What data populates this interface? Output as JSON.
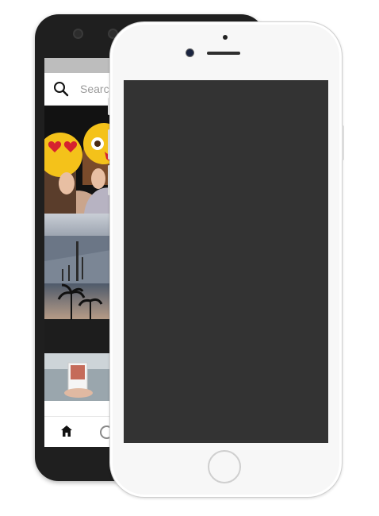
{
  "back_phone": {
    "search": {
      "placeholder": "Search",
      "icon": "search-icon"
    },
    "feed": [
      {
        "name": "emoji-masks-photo"
      },
      {
        "name": "pier-sea-photo"
      },
      {
        "name": "palm-sunset-photo"
      },
      {
        "name": "polaroid-photo"
      }
    ],
    "nav": {
      "home_icon": "home-icon",
      "explore_icon": "explore-icon"
    }
  },
  "front_phone": {
    "screen_color": "#333333",
    "body_color": "#f7f7f7"
  }
}
